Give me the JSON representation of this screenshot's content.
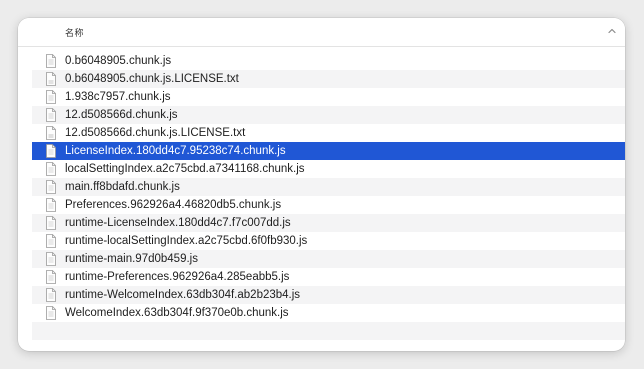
{
  "header": {
    "column_name": "名称",
    "sort_icon": "chevron-up-icon"
  },
  "files": [
    {
      "name": "0.b6048905.chunk.js",
      "icon": "document-icon"
    },
    {
      "name": "0.b6048905.chunk.js.LICENSE.txt",
      "icon": "text-document-icon"
    },
    {
      "name": "1.938c7957.chunk.js",
      "icon": "document-icon"
    },
    {
      "name": "12.d508566d.chunk.js",
      "icon": "document-icon"
    },
    {
      "name": "12.d508566d.chunk.js.LICENSE.txt",
      "icon": "text-document-icon"
    },
    {
      "name": "LicenseIndex.180dd4c7.95238c74.chunk.js",
      "icon": "document-icon",
      "selected": true
    },
    {
      "name": "localSettingIndex.a2c75cbd.a7341168.chunk.js",
      "icon": "document-icon"
    },
    {
      "name": "main.ff8bdafd.chunk.js",
      "icon": "document-icon"
    },
    {
      "name": "Preferences.962926a4.46820db5.chunk.js",
      "icon": "document-icon"
    },
    {
      "name": "runtime-LicenseIndex.180dd4c7.f7c007dd.js",
      "icon": "document-icon"
    },
    {
      "name": "runtime-localSettingIndex.a2c75cbd.6f0fb930.js",
      "icon": "document-icon"
    },
    {
      "name": "runtime-main.97d0b459.js",
      "icon": "document-icon"
    },
    {
      "name": "runtime-Preferences.962926a4.285eabb5.js",
      "icon": "document-icon"
    },
    {
      "name": "runtime-WelcomeIndex.63db304f.ab2b23b4.js",
      "icon": "document-icon"
    },
    {
      "name": "WelcomeIndex.63db304f.9f370e0b.chunk.js",
      "icon": "document-icon"
    }
  ],
  "colors": {
    "selection": "#2057d5",
    "stripe": "#f4f4f5"
  }
}
